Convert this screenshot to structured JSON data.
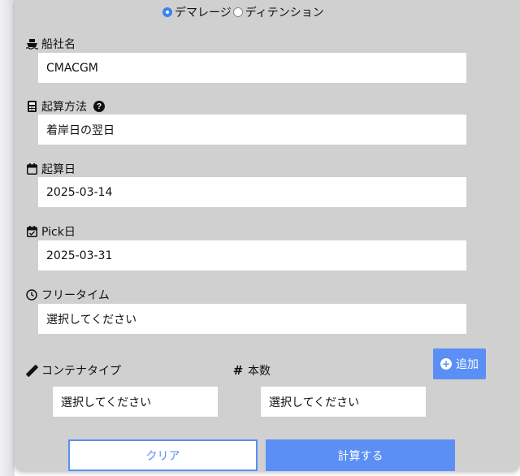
{
  "mode": {
    "options": [
      {
        "label": "デマレージ",
        "checked": true
      },
      {
        "label": "ディテンション",
        "checked": false
      }
    ]
  },
  "fields": {
    "carrier": {
      "label": "船社名",
      "value": "CMACGM",
      "icon": "ship-icon"
    },
    "calc_method": {
      "label": "起算方法",
      "value": "着岸日の翌日",
      "icon": "calculator-icon",
      "help": "?"
    },
    "start_date": {
      "label": "起算日",
      "value": "2025-03-14",
      "icon": "calendar-icon"
    },
    "pick_date": {
      "label": "Pick日",
      "value": "2025-03-31",
      "icon": "calendar-check-icon"
    },
    "free_time": {
      "label": "フリータイム",
      "value": "選択してください",
      "icon": "clock-icon"
    },
    "container_type": {
      "label": "コンテナタイプ",
      "value": "選択してください",
      "icon": "ruler-icon"
    },
    "quantity": {
      "label": "本数",
      "value": "選択してください",
      "icon": "hash-icon"
    }
  },
  "buttons": {
    "add": "追加",
    "clear": "クリア",
    "calculate": "計算する"
  },
  "colors": {
    "accent": "#5b8ff5",
    "panel": "#d0d0d0"
  }
}
